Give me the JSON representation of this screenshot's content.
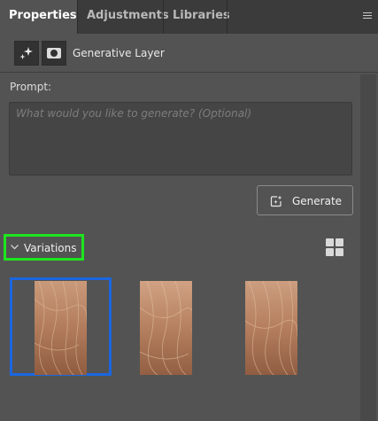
{
  "tabs": [
    {
      "label": "Properties",
      "active": true
    },
    {
      "label": "Adjustments",
      "active": false
    },
    {
      "label": "Libraries",
      "active": false
    }
  ],
  "panel_menu_icon": "hamburger-menu-icon",
  "layer": {
    "title": "Generative Layer",
    "icons": [
      "generative-sparkle-icon",
      "layer-mask-icon"
    ]
  },
  "prompt": {
    "label": "Prompt:",
    "value": "",
    "placeholder": "What would you like to generate? (Optional)"
  },
  "generate_button": {
    "label": "Generate",
    "icon": "generate-sparkle-icon"
  },
  "variations": {
    "label": "Variations",
    "expanded": true,
    "view_icon": "grid-view-icon",
    "selected_index": 0,
    "items": [
      {
        "thumbnail": "hair-texture-1"
      },
      {
        "thumbnail": "hair-texture-2"
      },
      {
        "thumbnail": "hair-texture-3"
      }
    ]
  },
  "colors": {
    "panel_bg": "#535353",
    "tabbar_bg": "#3b3b3b",
    "selection_border": "#1a66e0",
    "highlight_border": "#1ee51e",
    "thumbnail_tone": "#b07a5a"
  }
}
